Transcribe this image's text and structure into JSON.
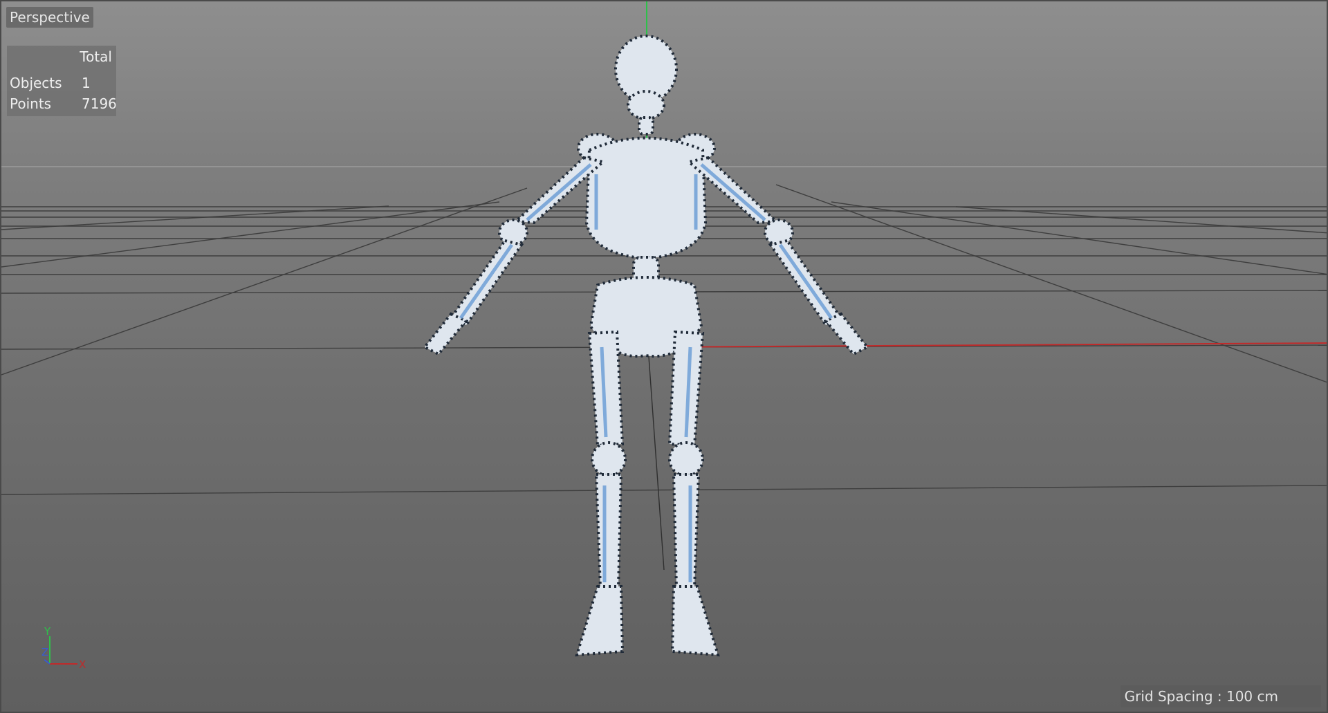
{
  "viewport": {
    "label": "Perspective",
    "stats": {
      "header": "Total",
      "rows": [
        {
          "label": "Objects",
          "value": "1"
        },
        {
          "label": "Points",
          "value": "7196"
        }
      ]
    },
    "grid_spacing": "Grid Spacing : 100 cm",
    "axis_labels": {
      "y": "Y",
      "z": "Z",
      "x": "X"
    }
  },
  "colors": {
    "x_axis": "#c02a2a",
    "y_axis": "#2ec04a",
    "z_axis": "#3a5cd0",
    "bone_fill": "#dfe6ee",
    "bone_shade": "#6f9fd6",
    "points": "#1f2a38"
  }
}
